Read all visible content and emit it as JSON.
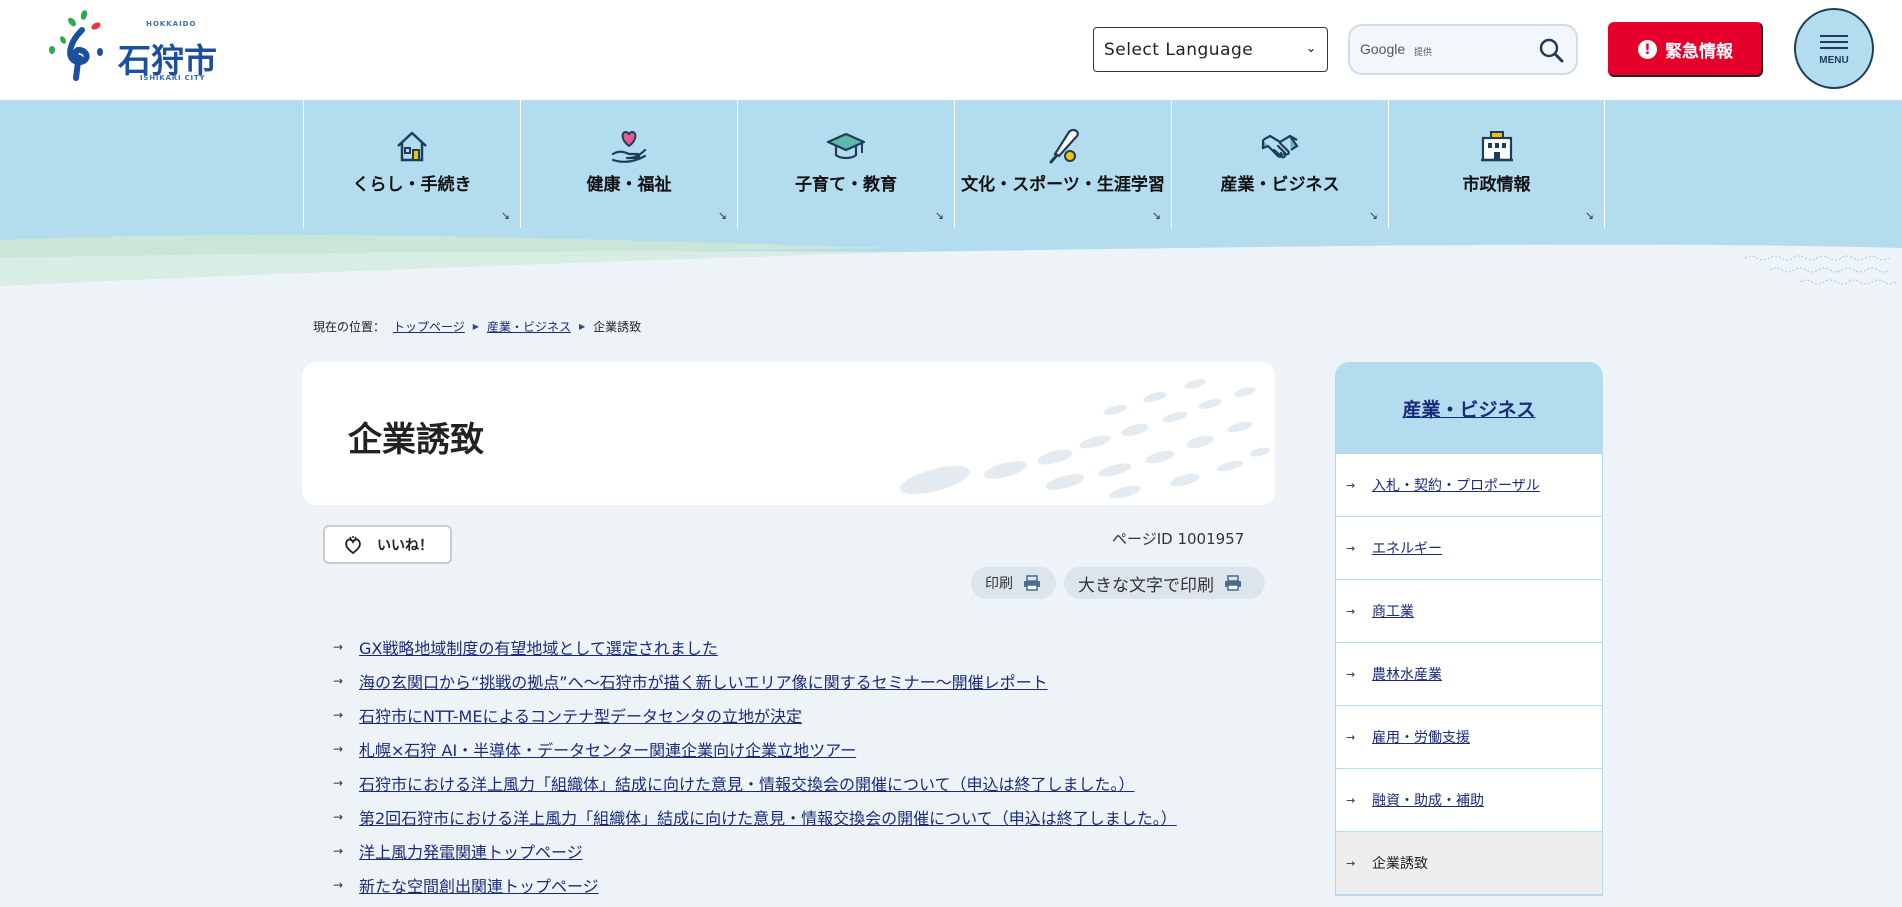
{
  "header": {
    "logo": {
      "small_top": "HOKKAIDO",
      "name": "石狩市",
      "small_bottom": "ISHIKARI CITY"
    },
    "language_select": {
      "value": "Select Language"
    },
    "google_search": {
      "brand": "Google",
      "sub": "提供"
    },
    "emergency_label": "緊急情報",
    "menu_label": "MENU"
  },
  "nav": {
    "items": [
      {
        "label": "くらし・手続き",
        "icon": "house-icon"
      },
      {
        "label": "健康・福祉",
        "icon": "heart-hand-icon"
      },
      {
        "label": "子育て・教育",
        "icon": "graduation-cap-icon"
      },
      {
        "label": "文化・スポーツ・生涯学習",
        "icon": "bat-ball-icon"
      },
      {
        "label": "産業・ビジネス",
        "icon": "handshake-icon"
      },
      {
        "label": "市政情報",
        "icon": "building-icon"
      }
    ]
  },
  "breadcrumb": {
    "prefix": "現在の位置：",
    "items": [
      "トップページ",
      "産業・ビジネス",
      "企業誘致"
    ]
  },
  "page": {
    "title": "企業誘致",
    "like_label": "いいね！",
    "page_id": "ページID 1001957",
    "print_label": "印刷",
    "print_large_label": "大きな文字で印刷"
  },
  "links": [
    "GX戦略地域制度の有望地域として選定されました",
    "海の玄関口から“挑戦の拠点”へ～石狩市が描く新しいエリア像に関するセミナー～開催レポート",
    "石狩市にNTT-MEによるコンテナ型データセンタの立地が決定",
    "札幌×石狩 AI・半導体・データセンター関連企業向け企業立地ツアー",
    "石狩市における洋上風力「組織体」結成に向けた意見・情報交換会の開催について（申込は終了しました。）",
    "第2回石狩市における洋上風力「組織体」結成に向けた意見・情報交換会の開催について（申込は終了しました。）",
    "洋上風力発電関連トップページ",
    "新たな空間創出関連トップページ"
  ],
  "sidebar": {
    "heading": "産業・ビジネス",
    "items": [
      "入札・契約・プロポーザル",
      "エネルギー",
      "商工業",
      "農林水産業",
      "雇用・労働支援",
      "融資・助成・補助",
      "企業誘致"
    ],
    "current_index": 6
  },
  "colors": {
    "nav_bg": "#b4dcef",
    "emergency_red": "#e4002b",
    "link": "#1a2b7a",
    "page_bg": "#eef3f8"
  }
}
